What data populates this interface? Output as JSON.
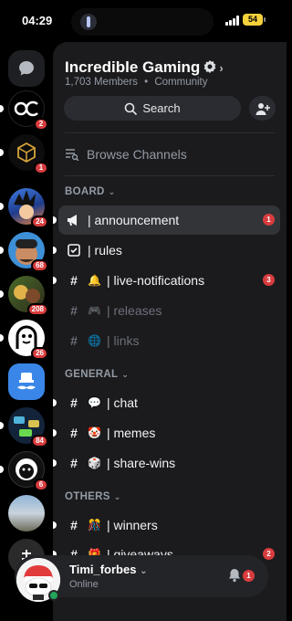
{
  "status_bar": {
    "time": "04:29",
    "battery": "54"
  },
  "server_rail": {
    "badges": [
      "2",
      "1",
      "24",
      "68",
      "208",
      "26",
      "84",
      "6"
    ]
  },
  "server": {
    "name": "Incredible Gaming",
    "members": "1,703 Members",
    "separator": "•",
    "type": "Community",
    "search_label": "Search",
    "browse_label": "Browse Channels"
  },
  "categories": {
    "board": "BOARD",
    "general": "GENERAL",
    "others": "OTHERS"
  },
  "channels": {
    "announcement": {
      "label": "| announcement",
      "count": "1"
    },
    "rules": {
      "label": "| rules"
    },
    "live_notifications": {
      "label": "| live-notifications",
      "count": "3"
    },
    "releases": {
      "label": "| releases"
    },
    "links": {
      "label": "| links"
    },
    "chat": {
      "label": "| chat"
    },
    "memes": {
      "label": "| memes"
    },
    "share_wins": {
      "label": "| share-wins"
    },
    "winners": {
      "label": "| winners"
    },
    "giveaways": {
      "label": "| giveaways",
      "count": "2"
    }
  },
  "user": {
    "name": "Timi_forbes",
    "status": "Online",
    "notifications": "1"
  },
  "colors": {
    "badge_red": "#d83c3e",
    "online_green": "#23a55a",
    "panel_bg": "#1b1b1e"
  }
}
